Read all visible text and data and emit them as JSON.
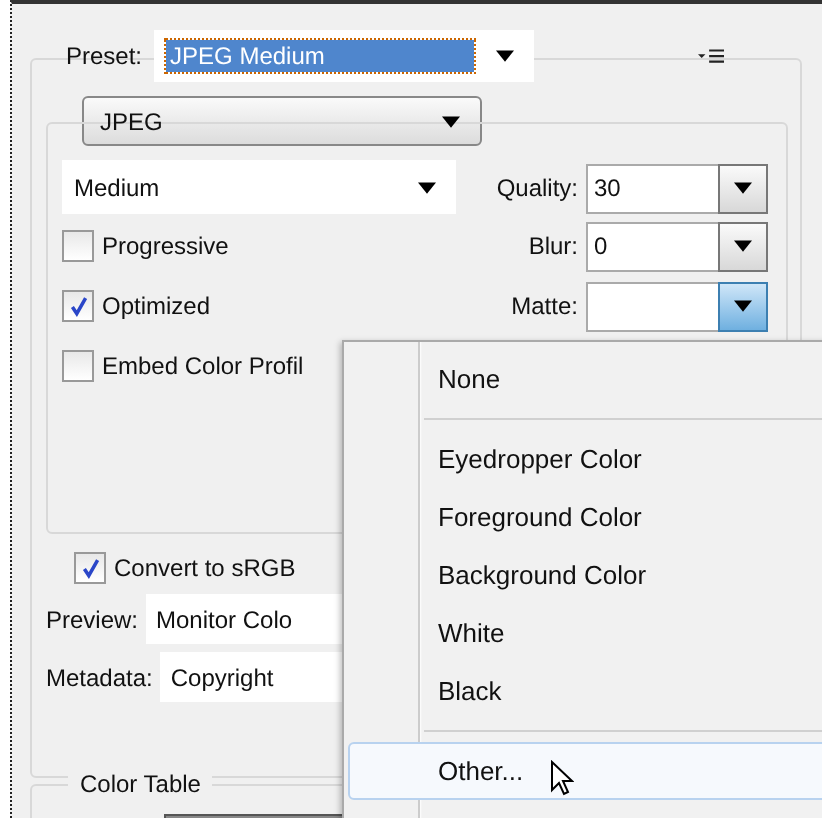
{
  "preset": {
    "label": "Preset:",
    "value": "JPEG Medium"
  },
  "format": {
    "value": "JPEG"
  },
  "quality_preset": {
    "value": "Medium"
  },
  "fields": [
    {
      "label": "Quality:",
      "value": "30",
      "open": false
    },
    {
      "label": "Blur:",
      "value": "0",
      "open": false
    },
    {
      "label": "Matte:",
      "open": true
    }
  ],
  "options": [
    {
      "label": "Progressive",
      "checked": false
    },
    {
      "label": "Optimized",
      "checked": true
    },
    {
      "label": "Embed Color Profil",
      "checked": false
    }
  ],
  "convert": {
    "label": "Convert to sRGB",
    "checked": true
  },
  "preview": {
    "label": "Preview:",
    "value": "Monitor Colo"
  },
  "metadata": {
    "label": "Metadata:",
    "value": "Copyright"
  },
  "color_table": {
    "title": "Color Table"
  },
  "matte_menu": {
    "groups": [
      [
        {
          "label": "None",
          "selected": false
        }
      ],
      [
        {
          "label": "Eyedropper Color",
          "selected": false
        },
        {
          "label": "Foreground Color",
          "selected": false
        },
        {
          "label": "Background Color",
          "selected": false
        },
        {
          "label": "White",
          "selected": false
        },
        {
          "label": "Black",
          "selected": false
        }
      ],
      [
        {
          "label": "Other...",
          "selected": true
        }
      ]
    ]
  }
}
